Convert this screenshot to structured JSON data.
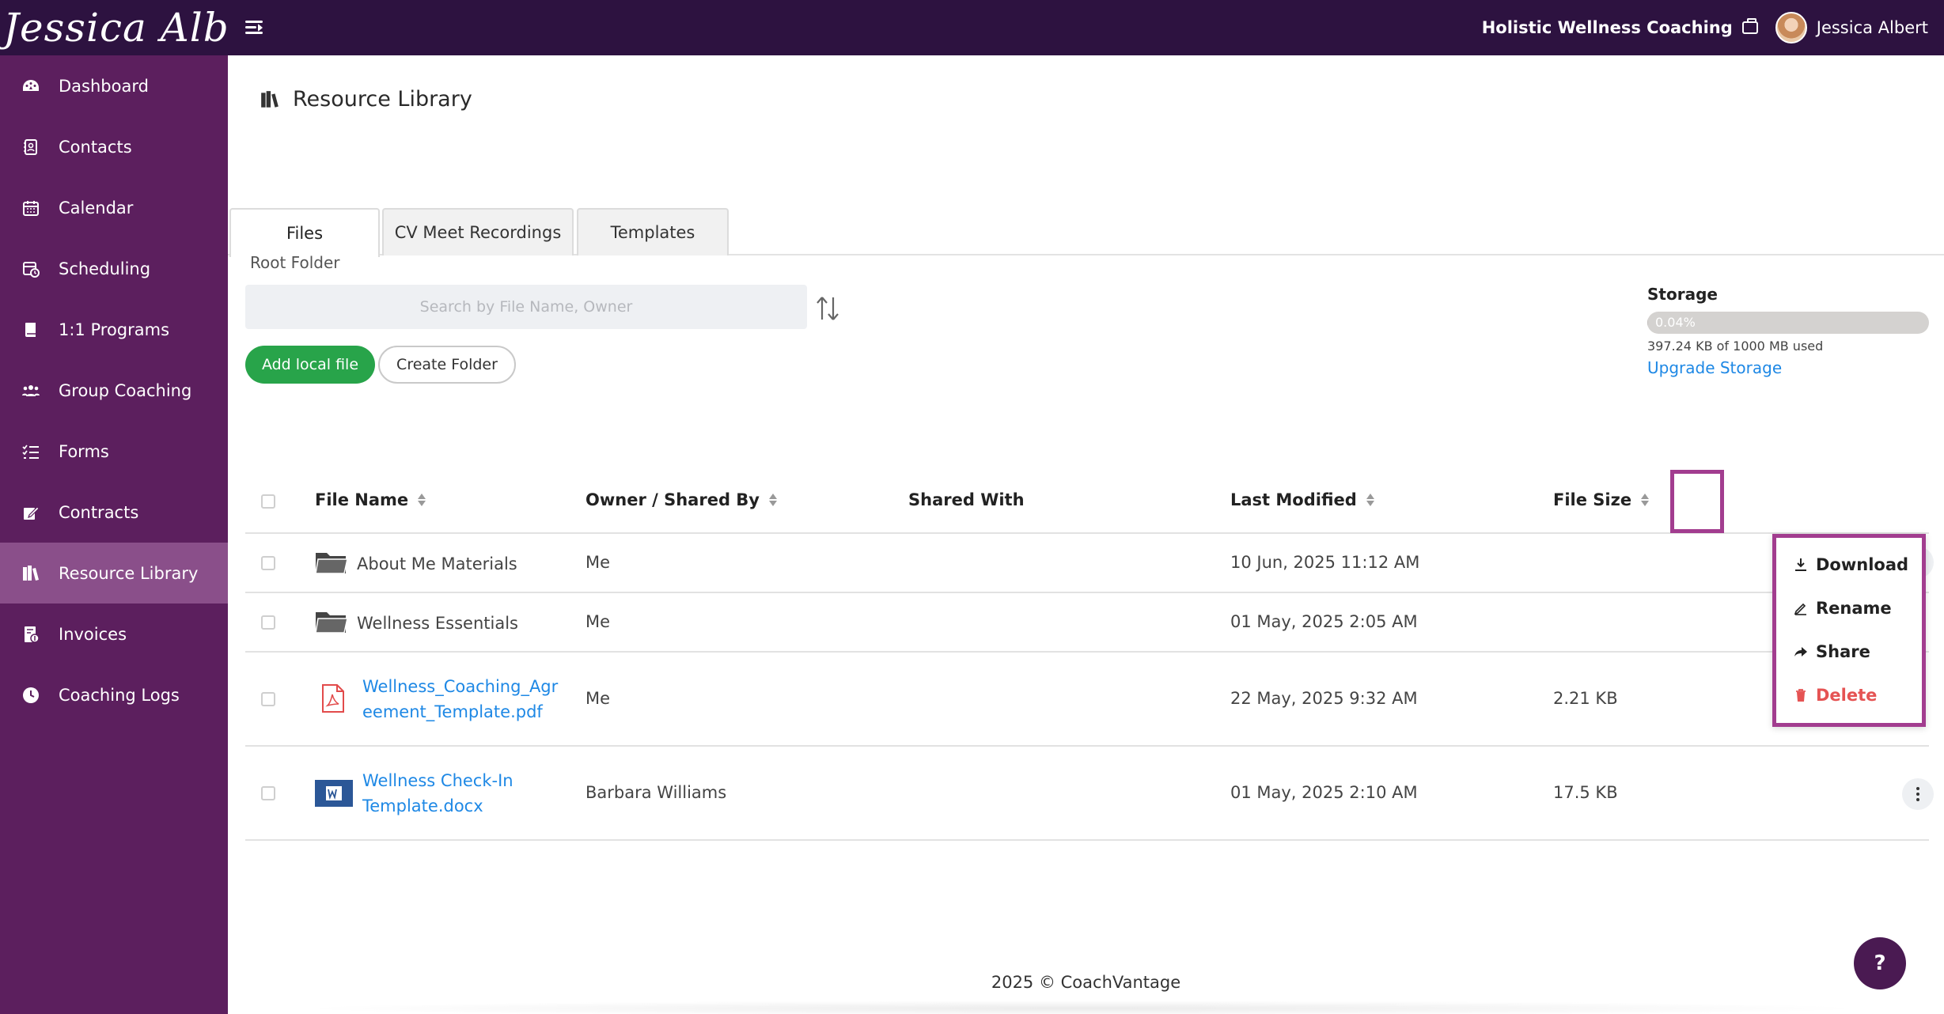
{
  "header": {
    "brand": "Jessica Albert",
    "org_name": "Holistic Wellness Coaching",
    "user_name": "Jessica Albert"
  },
  "sidebar": {
    "items": [
      {
        "label": "Dashboard",
        "icon": "dashboard-icon"
      },
      {
        "label": "Contacts",
        "icon": "contacts-icon"
      },
      {
        "label": "Calendar",
        "icon": "calendar-icon"
      },
      {
        "label": "Scheduling",
        "icon": "scheduling-icon"
      },
      {
        "label": "1:1 Programs",
        "icon": "book-icon"
      },
      {
        "label": "Group Coaching",
        "icon": "group-icon"
      },
      {
        "label": "Forms",
        "icon": "forms-icon"
      },
      {
        "label": "Contracts",
        "icon": "contract-icon"
      },
      {
        "label": "Resource Library",
        "icon": "library-icon",
        "active": true
      },
      {
        "label": "Invoices",
        "icon": "invoice-icon"
      },
      {
        "label": "Coaching Logs",
        "icon": "clock-icon"
      }
    ]
  },
  "page": {
    "title": "Resource Library",
    "tabs": [
      "Files",
      "CV Meet Recordings",
      "Templates"
    ],
    "active_tab": "Files",
    "folder_label": "Root Folder",
    "search_placeholder": "Search by File Name, Owner",
    "add_file_label": "Add local file",
    "create_folder_label": "Create Folder"
  },
  "storage": {
    "title": "Storage",
    "percent_label": "0.04%",
    "percent_value": 0.04,
    "used_label": "397.24 KB of 1000 MB used",
    "upgrade_label": "Upgrade Storage"
  },
  "table": {
    "columns": [
      "File Name",
      "Owner / Shared By",
      "Shared With",
      "Last Modified",
      "File Size"
    ],
    "rows": [
      {
        "type": "folder",
        "name_line1": "About Me Materials",
        "name_line2": "",
        "owner": "Me",
        "shared_with": "",
        "modified": "10 Jun, 2025 11:12 AM",
        "size": ""
      },
      {
        "type": "folder",
        "name_line1": "Wellness Essentials",
        "name_line2": "",
        "owner": "Me",
        "shared_with": "",
        "modified": "01 May, 2025 2:05 AM",
        "size": ""
      },
      {
        "type": "pdf",
        "name_line1": "Wellness_Coaching_Agr",
        "name_line2": "eement_Template.pdf",
        "owner": "Me",
        "shared_with": "",
        "modified": "22 May, 2025 9:32 AM",
        "size": "2.21 KB"
      },
      {
        "type": "docx",
        "name_line1": "Wellness Check-In",
        "name_line2": "Template.docx",
        "owner": "Barbara Williams",
        "shared_with": "",
        "modified": "01 May, 2025 2:10 AM",
        "size": "17.5 KB"
      }
    ]
  },
  "context_menu": {
    "items": [
      {
        "label": "Download",
        "icon": "download-icon"
      },
      {
        "label": "Rename",
        "icon": "pencil-icon"
      },
      {
        "label": "Share",
        "icon": "share-icon"
      },
      {
        "label": "Delete",
        "icon": "trash-icon",
        "danger": true
      }
    ]
  },
  "footer": {
    "text": "2025 © CoachVantage"
  },
  "help": {
    "label": "?"
  },
  "colors": {
    "topbar": "#2d1240",
    "sidebar": "#5c1f5e",
    "sidebar_active": "#8a4f8a",
    "accent_green": "#28a44a",
    "link_blue": "#1e88e5",
    "highlight": "#a23d8f",
    "danger": "#e55353"
  }
}
